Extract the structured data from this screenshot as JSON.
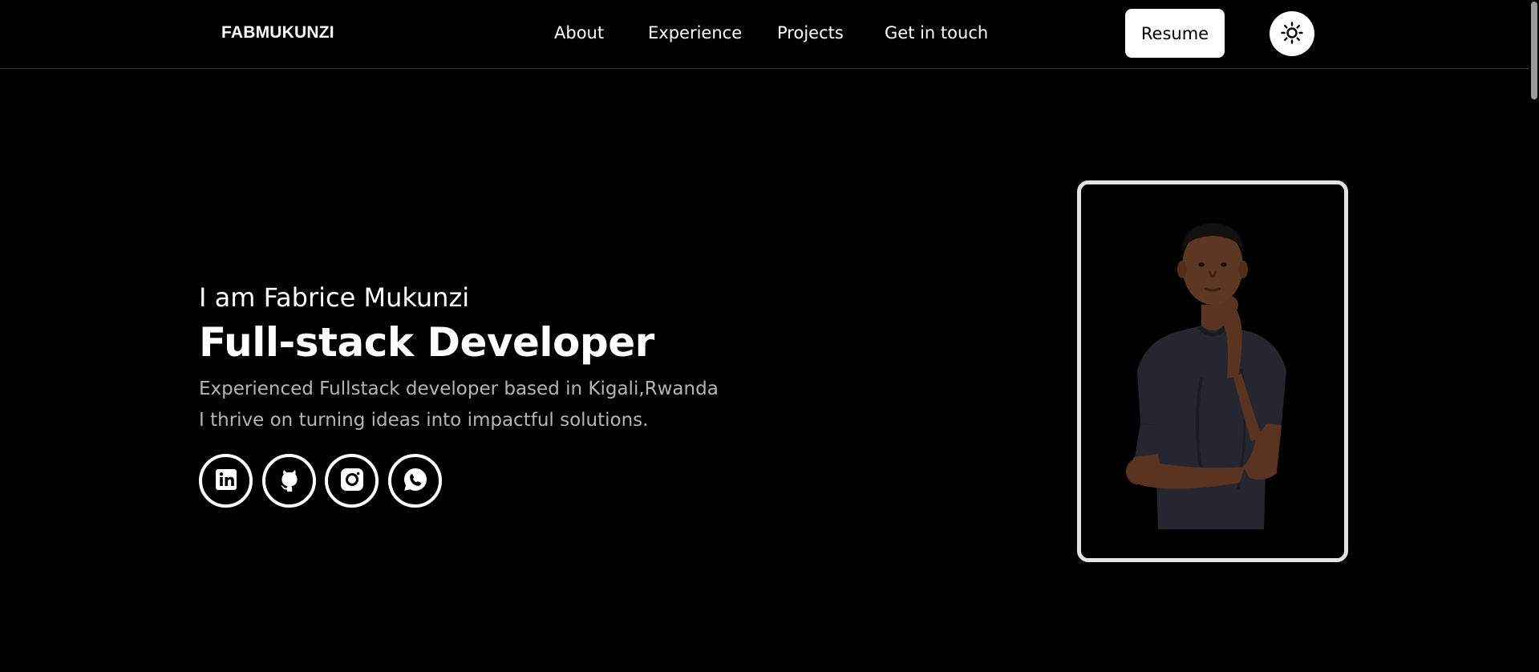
{
  "header": {
    "brand": "FABMUKUNZI",
    "nav": [
      "About",
      "Experience",
      "Projects",
      "Get in touch"
    ],
    "resume_label": "Resume",
    "theme_icon": "sun-icon"
  },
  "hero": {
    "intro": "I am Fabrice Mukunzi",
    "title": "Full-stack Developer",
    "description_lines": [
      "Experienced Fullstack developer based in Kigali,Rwanda",
      "I thrive on turning ideas into impactful solutions."
    ]
  },
  "socials": [
    {
      "icon": "linkedin-icon"
    },
    {
      "icon": "github-icon"
    },
    {
      "icon": "instagram-icon"
    },
    {
      "icon": "whatsapp-icon"
    }
  ],
  "portrait": {
    "icon": "profile-photo"
  },
  "colors": {
    "background": "#000000",
    "text": "#ffffff",
    "muted_text": "#b5b5b5",
    "card_border": "#e4e4e4",
    "divider": "#3a3a3a"
  }
}
